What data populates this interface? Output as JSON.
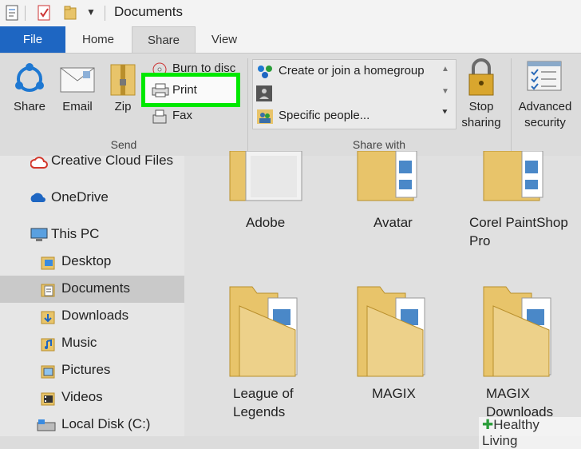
{
  "window": {
    "title": "Documents"
  },
  "tabs": {
    "file": "File",
    "home": "Home",
    "share": "Share",
    "view": "View"
  },
  "ribbon": {
    "send": {
      "group_label": "Send",
      "share": "Share",
      "email": "Email",
      "zip": "Zip",
      "burn": "Burn to disc",
      "print": "Print",
      "fax": "Fax"
    },
    "share_with": {
      "group_label": "Share with",
      "homegroup": "Create or join a homegroup",
      "specific": "Specific people...",
      "stop_sharing_1": "Stop",
      "stop_sharing_2": "sharing"
    },
    "advanced": {
      "line1": "Advanced",
      "line2": "security"
    }
  },
  "nav": {
    "items": [
      {
        "label": "Creative Cloud Files"
      },
      {
        "label": "OneDrive"
      },
      {
        "label": "This PC"
      },
      {
        "label": "Desktop"
      },
      {
        "label": "Documents"
      },
      {
        "label": "Downloads"
      },
      {
        "label": "Music"
      },
      {
        "label": "Pictures"
      },
      {
        "label": "Videos"
      },
      {
        "label": "Local Disk (C:)"
      }
    ]
  },
  "folders": [
    {
      "line1": "Adobe",
      "line2": ""
    },
    {
      "line1": "Avatar",
      "line2": ""
    },
    {
      "line1": "Corel PaintShop",
      "line2": "Pro"
    },
    {
      "line1": "League of",
      "line2": "Legends"
    },
    {
      "line1": "MAGIX",
      "line2": ""
    },
    {
      "line1": "MAGIX",
      "line2": "Downloads"
    }
  ],
  "watermark": "Healthy Living",
  "colors": {
    "file_tab": "#1e66c2",
    "highlight": "#00e800",
    "folder": "#e8c46a"
  }
}
